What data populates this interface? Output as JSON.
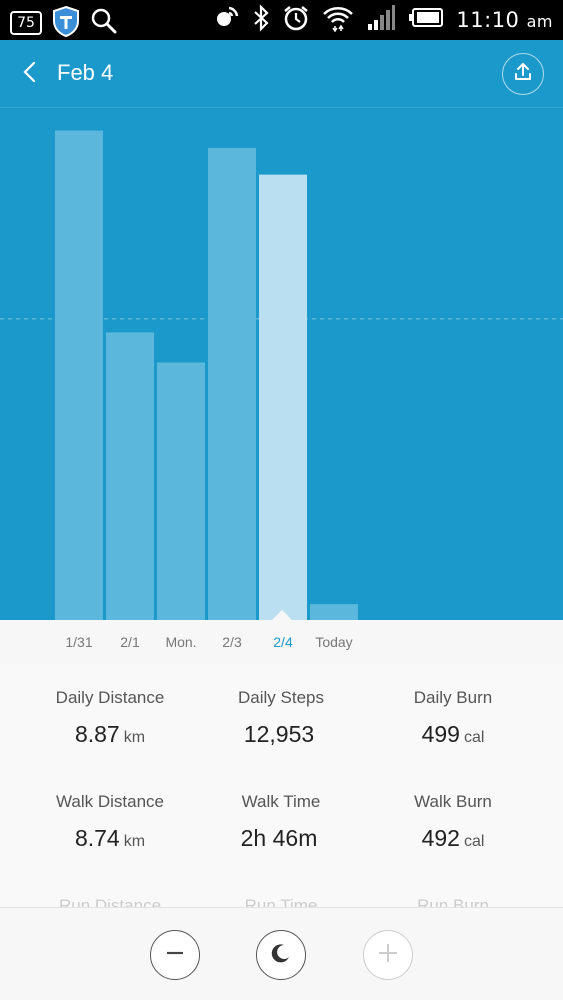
{
  "status_bar": {
    "battery_percent": "75",
    "time": "11:10",
    "ampm": "am",
    "icons": [
      "shield-icon",
      "search-icon",
      "location-icon",
      "bluetooth-icon",
      "alarm-icon",
      "wifi-icon",
      "signal-icon",
      "battery-icon"
    ]
  },
  "header": {
    "title": "Feb 4",
    "back_icon": "chevron-left-icon",
    "share_icon": "share-upload-icon"
  },
  "chart_data": {
    "type": "bar",
    "categories": [
      "1/31",
      "2/1",
      "Mon.",
      "2/3",
      "2/4",
      "Today"
    ],
    "values": [
      13000,
      7640,
      6840,
      12540,
      11830,
      420
    ],
    "selected_index": 4,
    "ylim": [
      0,
      13600
    ],
    "reference_line": 8000,
    "colors": {
      "background": "#1b99cb",
      "bar": "#5bb7dc",
      "bar_selected": "#b9dff0",
      "reference_line": "#7cc3e3"
    }
  },
  "stats": [
    {
      "label": "Daily Distance",
      "value": "8.87",
      "unit": "km"
    },
    {
      "label": "Daily Steps",
      "value": "12,953",
      "unit": ""
    },
    {
      "label": "Daily Burn",
      "value": "499",
      "unit": "cal"
    },
    {
      "label": "Walk Distance",
      "value": "8.74",
      "unit": "km"
    },
    {
      "label": "Walk Time",
      "value": "2h 46m",
      "unit": ""
    },
    {
      "label": "Walk Burn",
      "value": "492",
      "unit": "cal"
    }
  ],
  "faded_labels": [
    "Run Distance",
    "Run Time",
    "Run Burn"
  ],
  "controls": {
    "minus_icon": "minus-icon",
    "sleep_icon": "moon-icon",
    "plus_icon": "plus-icon"
  }
}
